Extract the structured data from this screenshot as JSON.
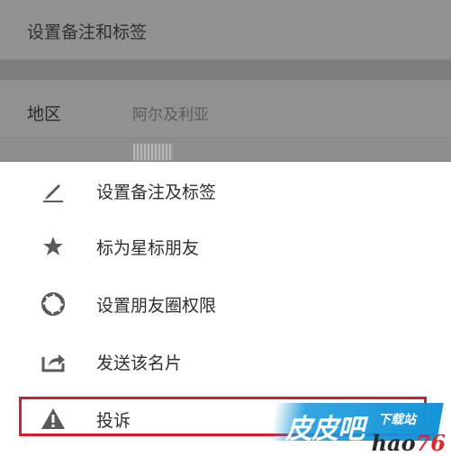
{
  "background": {
    "remark_row": "设置备注和标签",
    "region_label": "地区",
    "region_value": "阿尔及利亚"
  },
  "menu": {
    "items": [
      {
        "label": "设置备注及标签",
        "icon": "pencil-icon"
      },
      {
        "label": "标为星标朋友",
        "icon": "star-icon"
      },
      {
        "label": "设置朋友圈权限",
        "icon": "aperture-icon"
      },
      {
        "label": "发送该名片",
        "icon": "share-icon"
      },
      {
        "label": "投诉",
        "icon": "warning-icon"
      }
    ]
  },
  "watermark": {
    "main": "皮皮吧",
    "sub": "下载站",
    "site_prefix": "hao",
    "site_suffix": "76"
  },
  "colors": {
    "highlight": "#d21f2a",
    "icon": "#5a5a5a",
    "watermark_blue": "#1494d8"
  }
}
